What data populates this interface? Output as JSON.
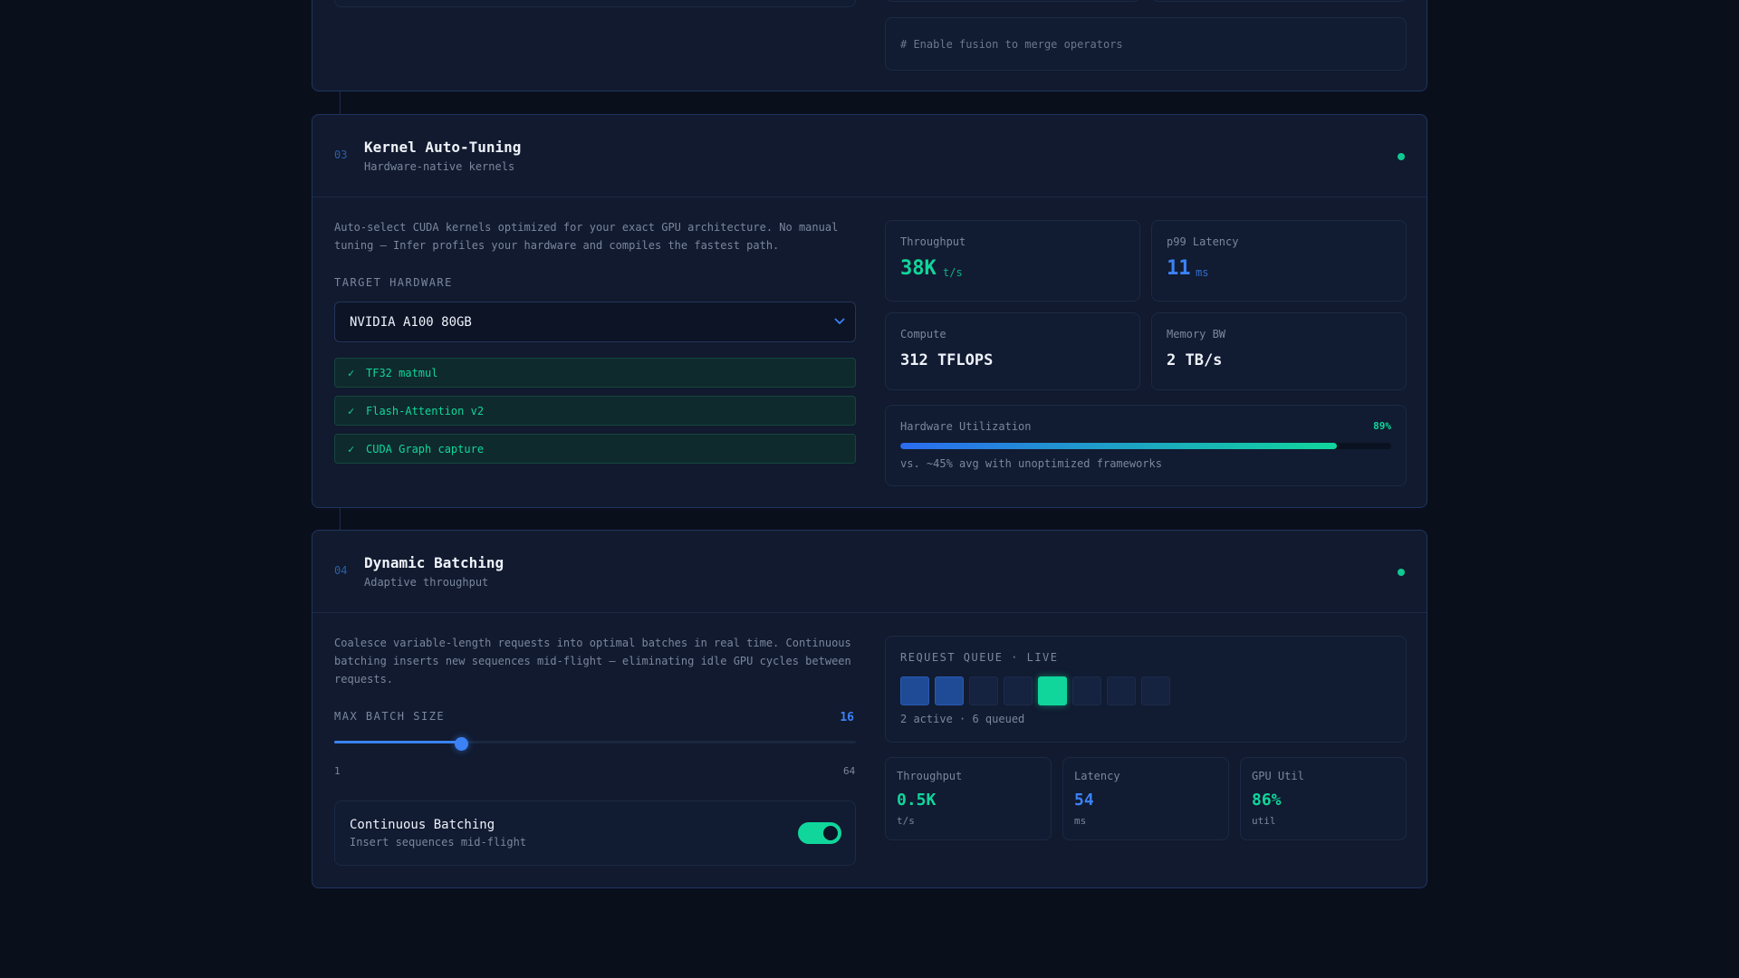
{
  "top_card": {
    "code_comment": "# Enable fusion to merge operators"
  },
  "kernel": {
    "number": "03",
    "title": "Kernel Auto-Tuning",
    "subtitle": "Hardware-native kernels",
    "description": "Auto-select CUDA kernels optimized for your exact GPU architecture. No manual tuning — Infer profiles your hardware and compiles the fastest path.",
    "target_label": "TARGET HARDWARE",
    "hardware_selected": "NVIDIA A100 80GB",
    "features": [
      {
        "check": "✓",
        "label": "TF32 matmul"
      },
      {
        "check": "✓",
        "label": "Flash-Attention v2"
      },
      {
        "check": "✓",
        "label": "CUDA Graph capture"
      }
    ],
    "metrics": {
      "throughput": {
        "label": "Throughput",
        "value": "38K",
        "unit": "t/s"
      },
      "latency": {
        "label": "p99 Latency",
        "value": "11",
        "unit": "ms"
      },
      "compute": {
        "label": "Compute",
        "value": "312 TFLOPS"
      },
      "memory": {
        "label": "Memory BW",
        "value": "2 TB/s"
      }
    },
    "utilization": {
      "label": "Hardware Utilization",
      "value_text": "89%",
      "fraction": 0.89,
      "note": "vs. ~45% avg with unoptimized frameworks"
    }
  },
  "batching": {
    "number": "04",
    "title": "Dynamic Batching",
    "subtitle": "Adaptive throughput",
    "description": "Coalesce variable-length requests into optimal batches in real time. Continuous batching inserts new sequences mid-flight — eliminating idle GPU cycles between requests.",
    "batch_label": "MAX BATCH SIZE",
    "batch_value": "16",
    "batch_fraction": 0.238,
    "slider_min": "1",
    "slider_max": "64",
    "continuous": {
      "title": "Continuous Batching",
      "subtitle": "Insert sequences mid-flight",
      "enabled": true
    },
    "queue": {
      "label": "REQUEST QUEUE · LIVE",
      "cells": [
        "active",
        "active",
        "queued",
        "queued",
        "hot",
        "queued",
        "queued",
        "queued"
      ],
      "summary": "2 active · 6 queued"
    },
    "stats": [
      {
        "label": "Throughput",
        "value": "0.5K",
        "unit": "t/s",
        "color": "#10d69b"
      },
      {
        "label": "Latency",
        "value": "54",
        "unit": "ms",
        "color": "#3b82f6"
      },
      {
        "label": "GPU Util",
        "value": "86%",
        "unit": "util",
        "color": "#10d69b"
      }
    ]
  },
  "colors": {
    "accent_green": "#10d69b",
    "accent_blue": "#3b82f6",
    "card_bg": "#111a2e",
    "page_bg": "#0a0f1c"
  }
}
